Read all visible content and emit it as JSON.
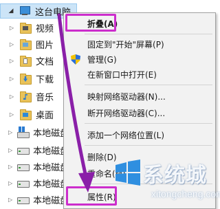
{
  "tree": {
    "root": {
      "expander": "◢",
      "label": "这台电脑"
    },
    "items": [
      {
        "label": "视频",
        "icon": "video-folder-icon"
      },
      {
        "label": "图片",
        "icon": "pictures-folder-icon"
      },
      {
        "label": "文档",
        "icon": "documents-folder-icon"
      },
      {
        "label": "下载",
        "icon": "downloads-folder-icon"
      },
      {
        "label": "音乐",
        "icon": "music-folder-icon"
      },
      {
        "label": "桌面",
        "icon": "desktop-folder-icon"
      },
      {
        "label": "本地磁盘",
        "icon": "windows-drive-icon"
      },
      {
        "label": "本地磁盘",
        "icon": "drive-icon"
      },
      {
        "label": "本地磁盘",
        "icon": "drive-icon"
      },
      {
        "label": "本地磁盘",
        "icon": "drive-icon"
      },
      {
        "label": "本地磁盘",
        "icon": "drive-icon"
      }
    ],
    "collapsed_expander": "▷"
  },
  "context_menu": {
    "items": [
      {
        "label": "折叠(A)",
        "bold": true
      },
      {
        "label": "固定到\"开始\"屏幕(P)"
      },
      {
        "label": "管理(G)",
        "icon": "shield-icon"
      },
      {
        "label": "在新窗口中打开(E)"
      },
      {
        "label": "映射网络驱动器(N)..."
      },
      {
        "label": "断开网络驱动器(C)..."
      },
      {
        "label": "添加一个网络位置(L)"
      },
      {
        "label": "删除(D)"
      },
      {
        "label": "重命名(M)"
      },
      {
        "label": "属性(R)"
      }
    ],
    "highlighted": [
      "折叠(A)",
      "属性(R)"
    ]
  },
  "annotation": {
    "arrow_color": "#8a1fa8",
    "box_color": "#cc2dcc"
  },
  "watermark": {
    "title": "系统城",
    "domain": "xitongcheng.com"
  }
}
